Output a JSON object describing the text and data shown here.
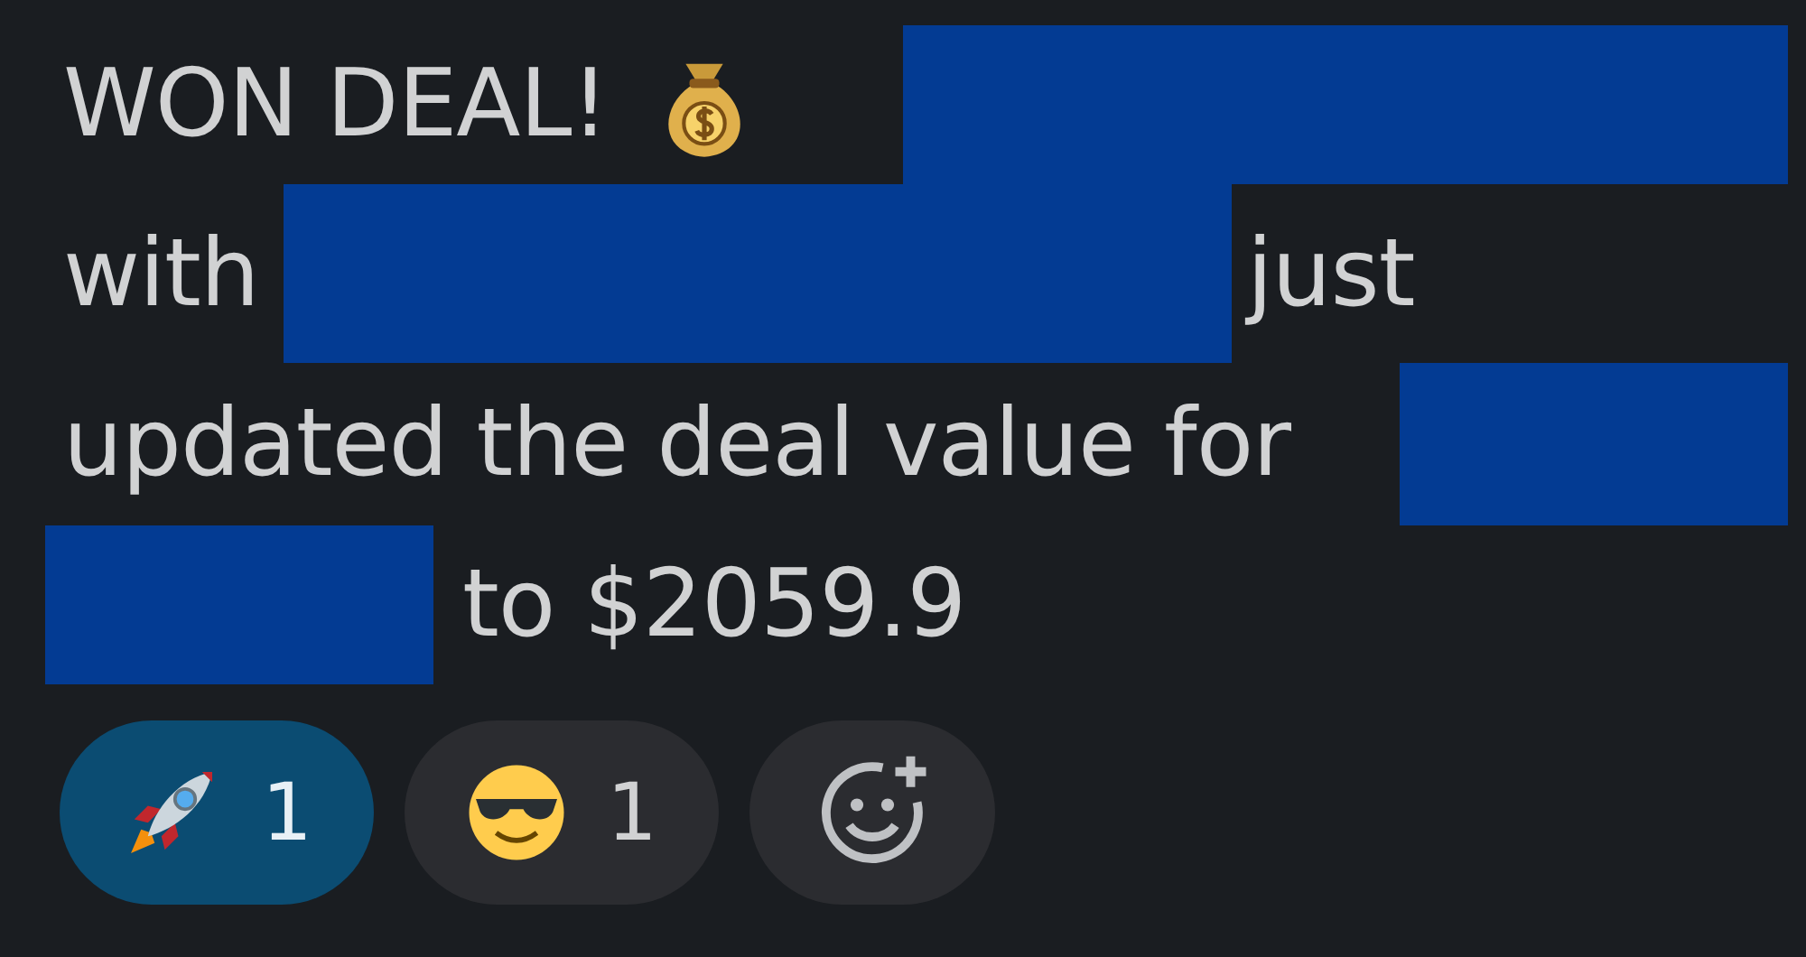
{
  "message": {
    "lines": [
      [
        {
          "kind": "text",
          "text": "WON DEAL!"
        },
        {
          "kind": "money-bag"
        },
        {
          "kind": "redacted"
        }
      ],
      [
        {
          "kind": "text",
          "text": "with"
        },
        {
          "kind": "redacted"
        },
        {
          "kind": "text",
          "text": "just"
        }
      ],
      [
        {
          "kind": "text",
          "text": "updated the deal value for"
        },
        {
          "kind": "redacted"
        }
      ],
      [
        {
          "kind": "redacted"
        },
        {
          "kind": "text",
          "text": "to $2059.9"
        }
      ]
    ]
  },
  "reactions": [
    {
      "kind": "rocket",
      "count": "1",
      "selected": true
    },
    {
      "kind": "sunglasses",
      "count": "1",
      "selected": false
    }
  ]
}
